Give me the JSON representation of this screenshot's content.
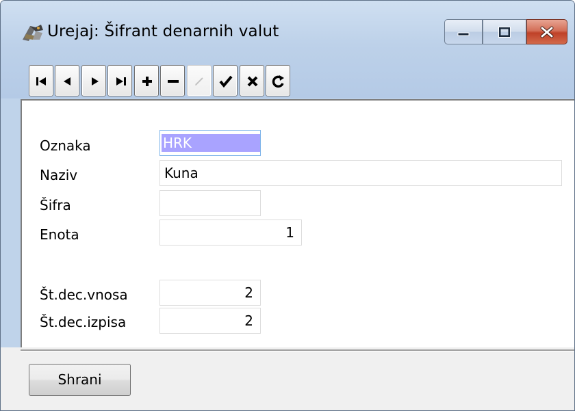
{
  "window": {
    "title": "Urejaj: Šifrant denarnih valut",
    "caption_buttons": [
      "minimize-icon",
      "maximize-icon",
      "close-icon"
    ]
  },
  "toolbar": {
    "buttons": [
      {
        "name": "first-record",
        "icon": "first-icon",
        "enabled": true
      },
      {
        "name": "prev-record",
        "icon": "prev-icon",
        "enabled": true
      },
      {
        "name": "next-record",
        "icon": "next-icon",
        "enabled": true
      },
      {
        "name": "last-record",
        "icon": "last-icon",
        "enabled": true
      },
      {
        "name": "insert-record",
        "icon": "plus-icon",
        "enabled": true
      },
      {
        "name": "delete-record",
        "icon": "minus-icon",
        "enabled": true
      },
      {
        "name": "edit-record",
        "icon": "edit-icon",
        "enabled": false
      },
      {
        "name": "post-record",
        "icon": "check-icon",
        "enabled": true
      },
      {
        "name": "cancel-record",
        "icon": "x-icon",
        "enabled": true
      },
      {
        "name": "refresh-record",
        "icon": "refresh-icon",
        "enabled": true
      }
    ]
  },
  "form": {
    "oznaka": {
      "label": "Oznaka",
      "value": "HRK"
    },
    "naziv": {
      "label": "Naziv",
      "value": "Kuna"
    },
    "sifra": {
      "label": "Šifra",
      "value": ""
    },
    "enota": {
      "label": "Enota",
      "value": "1"
    },
    "st_dec_vnosa": {
      "label": "Št.dec.vnosa",
      "value": "2"
    },
    "st_dec_izpisa": {
      "label": "Št.dec.izpisa",
      "value": "2"
    }
  },
  "footer": {
    "save_label": "Shrani"
  },
  "colors": {
    "frame": "#bfd3ea",
    "selection": "#a9a3ff",
    "close_button": "#c7462b"
  }
}
